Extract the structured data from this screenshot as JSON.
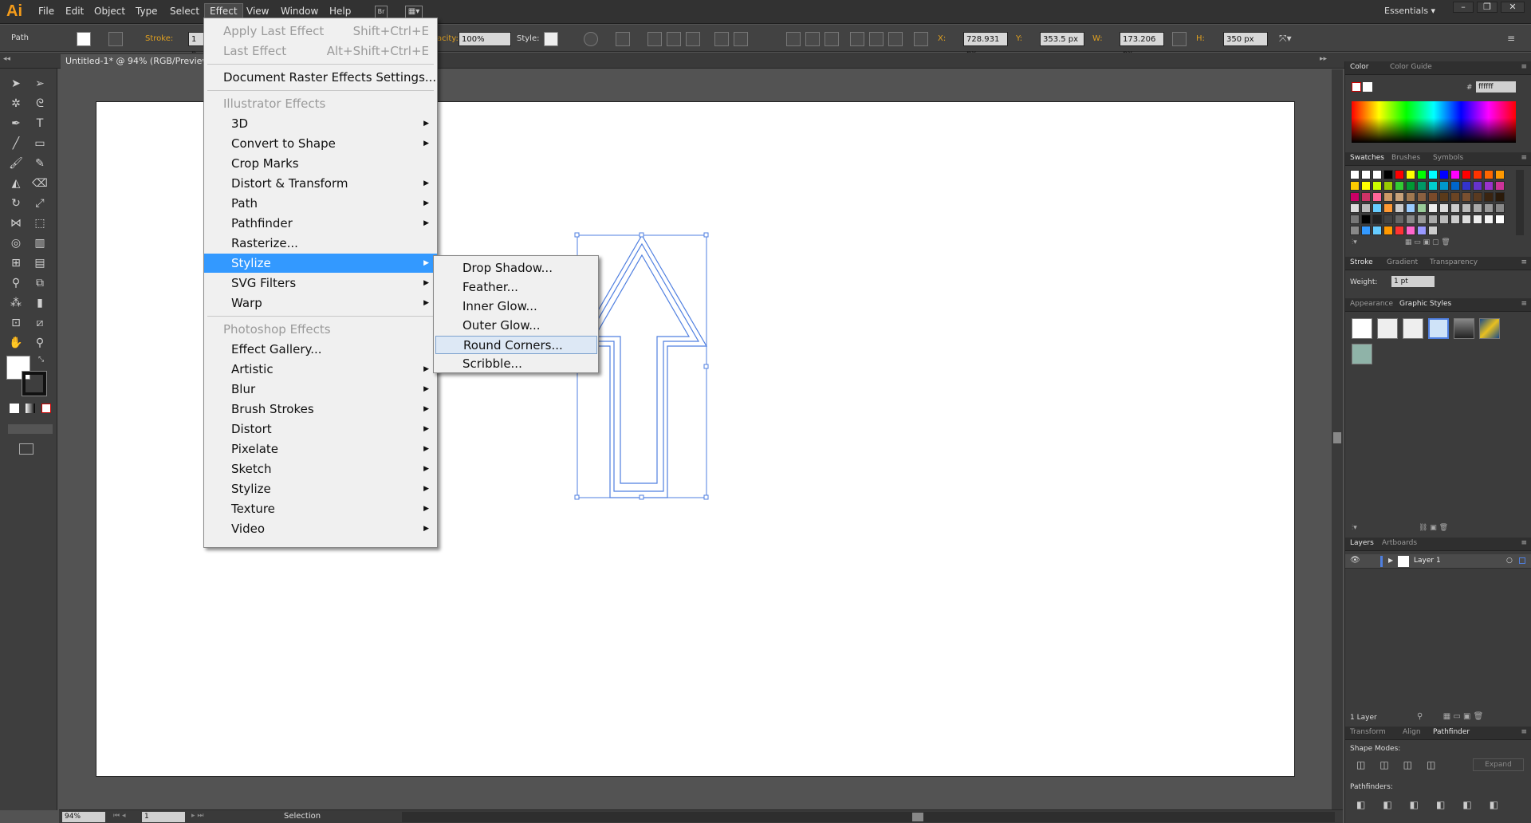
{
  "app": {
    "logo": "Ai",
    "workspace": "Essentials",
    "menu": [
      "File",
      "Edit",
      "Object",
      "Type",
      "Select",
      "Effect",
      "View",
      "Window",
      "Help"
    ],
    "bridge_label": "Br"
  },
  "control_bar": {
    "selection_type": "Path",
    "stroke_label": "Stroke:",
    "stroke_value": "1 p",
    "opacity_label": "acity:",
    "opacity_value": "100%",
    "style_label": "Style:",
    "x_label": "X:",
    "x_value": "728.931 px",
    "y_label": "Y:",
    "y_value": "353.5 px",
    "w_label": "W:",
    "w_value": "173.206 px",
    "h_label": "H:",
    "h_value": "350 px"
  },
  "document": {
    "tab_title": "Untitled-1* @ 94% (RGB/Preview)"
  },
  "status_bar": {
    "zoom": "94%",
    "page": "1",
    "tool": "Selection"
  },
  "effect_menu": {
    "items": [
      {
        "label": "Apply Last Effect",
        "shortcut": "Shift+Ctrl+E",
        "disabled": true
      },
      {
        "label": "Last Effect",
        "shortcut": "Alt+Shift+Ctrl+E",
        "disabled": true
      },
      {
        "label": "Document Raster Effects Settings..."
      },
      {
        "label": "Illustrator Effects",
        "header": true
      },
      {
        "label": "3D",
        "sub": true
      },
      {
        "label": "Convert to Shape",
        "sub": true
      },
      {
        "label": "Crop Marks"
      },
      {
        "label": "Distort & Transform",
        "sub": true
      },
      {
        "label": "Path",
        "sub": true
      },
      {
        "label": "Pathfinder",
        "sub": true
      },
      {
        "label": "Rasterize..."
      },
      {
        "label": "Stylize",
        "sub": true,
        "selected": true
      },
      {
        "label": "SVG Filters",
        "sub": true
      },
      {
        "label": "Warp",
        "sub": true
      },
      {
        "label": "Photoshop Effects",
        "header": true
      },
      {
        "label": "Effect Gallery..."
      },
      {
        "label": "Artistic",
        "sub": true
      },
      {
        "label": "Blur",
        "sub": true
      },
      {
        "label": "Brush Strokes",
        "sub": true
      },
      {
        "label": "Distort",
        "sub": true
      },
      {
        "label": "Pixelate",
        "sub": true
      },
      {
        "label": "Sketch",
        "sub": true
      },
      {
        "label": "Stylize",
        "sub": true
      },
      {
        "label": "Texture",
        "sub": true
      },
      {
        "label": "Video",
        "sub": true
      }
    ]
  },
  "stylize_submenu": {
    "items": [
      "Drop Shadow...",
      "Feather...",
      "Inner Glow...",
      "Outer Glow...",
      "Round Corners...",
      "Scribble..."
    ],
    "hovered_index": 4
  },
  "panels": {
    "color": {
      "tabs": [
        "Color",
        "Color Guide"
      ],
      "hex": "ffffff"
    },
    "swatches": {
      "tabs": [
        "Swatches",
        "Brushes",
        "Symbols"
      ]
    },
    "stroke": {
      "tabs": [
        "Stroke",
        "Gradient",
        "Transparency"
      ],
      "weight_label": "Weight:",
      "weight_value": "1 pt"
    },
    "appearance": {
      "tabs": [
        "Appearance",
        "Graphic Styles"
      ]
    },
    "layers": {
      "tabs": [
        "Layers",
        "Artboards"
      ],
      "layer_name": "Layer 1",
      "count": "1 Layer"
    },
    "pathfinder": {
      "tabs": [
        "Transform",
        "Align",
        "Pathfinder"
      ],
      "shape_modes": "Shape Modes:",
      "pathfinders": "Pathfinders:",
      "expand": "Expand"
    }
  },
  "colors": {
    "accent_menu": "#3399ff",
    "selection": "#4f7fe0",
    "logo": "#f59c1a"
  }
}
